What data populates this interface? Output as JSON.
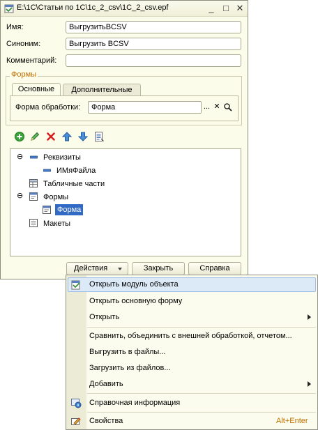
{
  "window": {
    "title": "E:\\1C\\Статьи по 1C\\1c_2_csv\\1C_2_csv.epf",
    "minimize_glyph": "_",
    "maximize_glyph": "□",
    "close_glyph": "✕"
  },
  "form": {
    "name_label": "Имя:",
    "name_value": "ВыгрузитьBCSV",
    "synonym_label": "Синоним:",
    "synonym_value": "Выгрузить BCSV",
    "comment_label": "Комментарий:",
    "comment_value": ""
  },
  "forms_group": {
    "title": "Формы",
    "tabs": [
      {
        "label": "Основные",
        "active": true
      },
      {
        "label": "Дополнительные",
        "active": false
      }
    ],
    "processing_form_label": "Форма обработки:",
    "processing_form_value": "Форма",
    "ellipsis": "...",
    "clear_glyph": "✕",
    "search_glyph": "🔍"
  },
  "toolbar": {
    "icons": [
      "add-icon",
      "edit-icon",
      "delete-icon",
      "move-up-icon",
      "move-down-icon",
      "list-icon"
    ]
  },
  "tree": {
    "items": [
      {
        "label": "Реквизиты",
        "level": 0,
        "expand": "⊖"
      },
      {
        "label": "ИМяФайла",
        "level": 1
      },
      {
        "label": "Табличные части",
        "level": 0
      },
      {
        "label": "Формы",
        "level": 0,
        "expand": "⊖"
      },
      {
        "label": "Форма",
        "level": 1,
        "selected": true
      },
      {
        "label": "Макеты",
        "level": 0
      }
    ]
  },
  "buttons": {
    "actions": "Действия",
    "close": "Закрыть",
    "help": "Справка"
  },
  "context_menu": {
    "items": [
      {
        "label": "Открыть модуль объекта",
        "highlighted": true
      },
      {
        "label": "Открыть основную форму"
      },
      {
        "label": "Открыть",
        "submenu": true
      },
      {
        "label": "Сравнить, объединить с внешней обработкой, отчетом..."
      },
      {
        "label": "Выгрузить в файлы..."
      },
      {
        "label": "Загрузить из файлов..."
      },
      {
        "label": "Добавить",
        "submenu": true
      },
      {
        "label": "Справочная информация"
      },
      {
        "label": "Свойства",
        "shortcut": "Alt+Enter"
      }
    ]
  },
  "colors": {
    "window_bg": "#fcfcea",
    "group_title": "#c07000",
    "selection": "#316ac5",
    "menu_highlight": "#dce9f7"
  }
}
